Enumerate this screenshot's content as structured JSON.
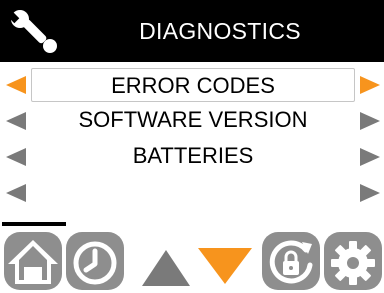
{
  "header": {
    "title": "DIAGNOSTICS",
    "icon": "wrench-icon"
  },
  "menu": {
    "items": [
      {
        "label": "ERROR CODES",
        "selected": true
      },
      {
        "label": "SOFTWARE VERSION",
        "selected": false
      },
      {
        "label": "BATTERIES",
        "selected": false
      },
      {
        "label": "",
        "selected": false
      }
    ]
  },
  "footer": {
    "buttons": [
      "home-icon",
      "clock-icon",
      "up-arrow-icon",
      "down-arrow-icon",
      "lock-icon",
      "gear-icon"
    ]
  },
  "colors": {
    "accent": "#f7941d",
    "inactive": "#8e8e8e",
    "header_bg": "#000000"
  }
}
